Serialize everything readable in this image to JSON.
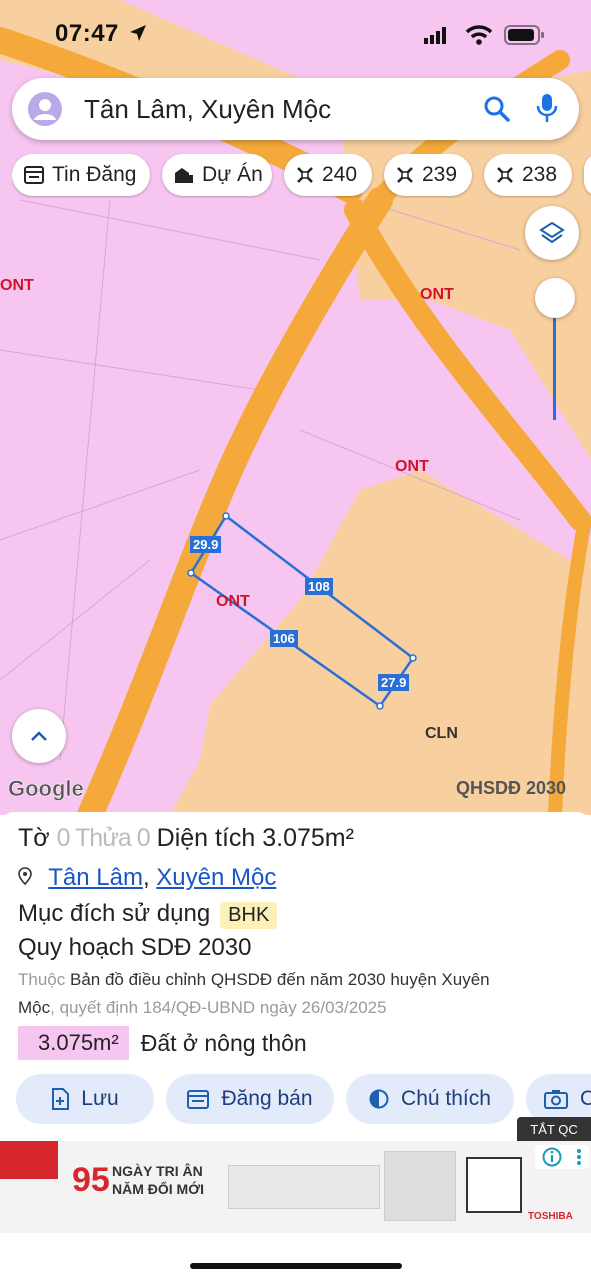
{
  "status_bar": {
    "time": "07:47"
  },
  "search": {
    "query": "Tân Lâm, Xuyên Mộc"
  },
  "chips": [
    {
      "label": "Tin Đăng",
      "icon": "listing-icon"
    },
    {
      "label": "Dự Án",
      "icon": "building-icon"
    },
    {
      "label": "240",
      "icon": "parcel-icon"
    },
    {
      "label": "239",
      "icon": "parcel-icon"
    },
    {
      "label": "238",
      "icon": "parcel-icon"
    }
  ],
  "map": {
    "labels": {
      "ont_left": "ONT",
      "ont_top": "ONT",
      "ont_mid": "ONT",
      "ont_parcel": "ONT",
      "cln": "CLN"
    },
    "edges": {
      "top_left": "29.9",
      "top": "108",
      "bottom": "106",
      "right": "27.9"
    },
    "google_logo": "Google",
    "layer_label": "QHSDĐ 2030",
    "colors": {
      "residential": "#f7c6f0",
      "cropland": "#f8cf9f",
      "road": "#f5a93a",
      "parcel_outline": "#2a6fd6"
    }
  },
  "panel": {
    "title_prefix": "Tờ",
    "title_obscured": "0 Thửa 0",
    "area_label": "Diện tích 3.075m²",
    "location_commune": "Tân Lâm",
    "location_sep": ",",
    "location_district": "Xuyên Mộc",
    "purpose_label": "Mục đích sử dụng",
    "purpose_badge": "BHK",
    "plan_label": "Quy hoạch SDĐ 2030",
    "plan_desc_prefix": "Thuộc",
    "plan_desc_main1": "Bản đồ điều chỉnh QHSDĐ đến năm 2030 huyện Xuyên",
    "plan_desc_main2": "Mộc",
    "plan_desc_suffix": ", quyết định 184/QĐ-UBND ngày 26/03/2025",
    "area_value": "3.075m²",
    "area_type": "Đất ở nông thôn",
    "actions": [
      {
        "label": "Lưu",
        "icon": "add-file-icon"
      },
      {
        "label": "Đăng bán",
        "icon": "calendar-icon"
      },
      {
        "label": "Chú thích",
        "icon": "contrast-icon"
      },
      {
        "label": "C",
        "icon": "camera-icon"
      }
    ]
  },
  "ad": {
    "close_label": "TẮT QC",
    "headline_num": "95",
    "headline_line1": "NGÀY TRI ÂN",
    "headline_line2": "NĂM ĐỔI MỚI",
    "brand": "TOSHIBA"
  }
}
